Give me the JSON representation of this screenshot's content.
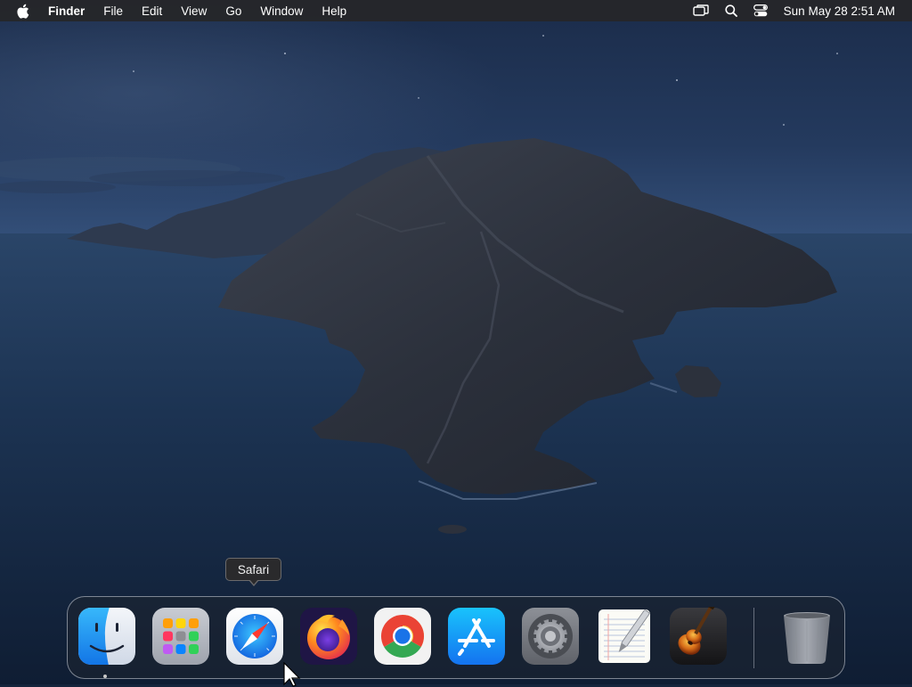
{
  "menubar": {
    "app_name": "Finder",
    "items": [
      "File",
      "Edit",
      "View",
      "Go",
      "Window",
      "Help"
    ],
    "clock": "Sun May 28  2:51 AM"
  },
  "tooltip": {
    "label": "Safari"
  },
  "dock": {
    "items": [
      {
        "name": "Finder",
        "icon": "finder-icon",
        "running": true
      },
      {
        "name": "Launchpad",
        "icon": "launchpad-icon",
        "running": false
      },
      {
        "name": "Safari",
        "icon": "safari-icon",
        "running": false
      },
      {
        "name": "Firefox",
        "icon": "firefox-icon",
        "running": false
      },
      {
        "name": "Google Chrome",
        "icon": "chrome-icon",
        "running": false
      },
      {
        "name": "App Store",
        "icon": "app-store-icon",
        "running": false
      },
      {
        "name": "System Preferences",
        "icon": "system-preferences-icon",
        "running": false
      },
      {
        "name": "TextEdit",
        "icon": "textedit-icon",
        "running": false
      },
      {
        "name": "GarageBand",
        "icon": "garageband-icon",
        "running": false
      },
      {
        "name": "Trash",
        "icon": "trash-icon",
        "running": false
      }
    ]
  },
  "status_icons": [
    "screen-mirroring-icon",
    "spotlight-search-icon",
    "control-center-icon"
  ]
}
